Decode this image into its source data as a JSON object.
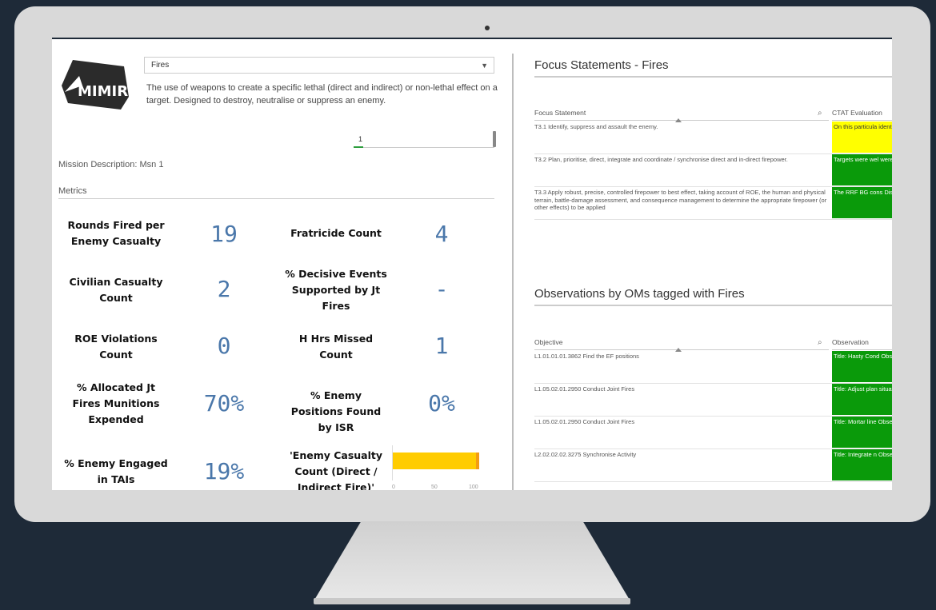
{
  "logo": {
    "text": "MIMIR"
  },
  "filter": {
    "selected": "Fires"
  },
  "description": "The use of weapons to create a specific lethal (direct and indirect) or non-lethal effect on a target. Designed to destroy, neutralise or suppress an enemy.",
  "slider": {
    "value": "1"
  },
  "mission": "Mission Description: Msn 1",
  "metrics_title": "Metrics",
  "metrics": {
    "rounds_fired": {
      "label": "Rounds Fired per Enemy Casualty",
      "value": "19"
    },
    "fratricide": {
      "label": "Fratricide Count",
      "value": "4"
    },
    "civilian": {
      "label": "Civilian Casualty Count",
      "value": "2"
    },
    "decisive": {
      "label": "% Decisive Events Supported by Jt Fires",
      "value": "-"
    },
    "roe": {
      "label": "ROE Violations Count",
      "value": "0"
    },
    "hhrs": {
      "label": "H Hrs Missed Count",
      "value": "1"
    },
    "allocated": {
      "label": "% Allocated Jt Fires Munitions Expended",
      "value": "70%"
    },
    "positions": {
      "label": "% Enemy Positions Found by ISR",
      "value": "0%"
    },
    "engaged": {
      "label": "% Enemy Engaged in TAIs",
      "value": "19%"
    },
    "casualty_chart": {
      "label": "'Enemy Casualty Count (Direct / Indirect Fire)'"
    }
  },
  "chart_data": {
    "type": "bar",
    "orientation": "horizontal",
    "series": [
      {
        "values": [
          96
        ]
      },
      {
        "values": [
          4
        ]
      }
    ],
    "stacked": true,
    "xlim": [
      0,
      100
    ],
    "ticks": [
      "0",
      "50",
      "100"
    ],
    "colors": [
      "#ffcc00",
      "#f39c12"
    ]
  },
  "focus": {
    "title": "Focus Statements - Fires",
    "col1": "Focus Statement",
    "col2": "CTAT Evaluation",
    "rows": [
      {
        "statement": "T3.1 Identify, suppress and assault the enemy.",
        "evaluation": "On this particula identify and supp a conplan that lef",
        "color": "yellow"
      },
      {
        "statement": "T3.2 Plan, prioritise, direct, integrate and coordinate / synchronise direct and in-direct firepower.",
        "evaluation": "Targets were wel were planned in a coordination was",
        "color": "green"
      },
      {
        "statement": "T3.3 Apply robust, precise, controlled firepower to best effect, taking account of ROE, the human and physical terrain, battle-damage assessment, and consequence management to determine the appropriate firepower (or other effects) to be applied",
        "evaluation": "The RRF BG cons Discovering the r by civilians, the B",
        "color": "green"
      }
    ]
  },
  "observations": {
    "title": "Observations by OMs tagged with Fires",
    "col1": "Objective",
    "col2": "Observation",
    "rows": [
      {
        "objective": "L1.01.01.01.3862 Find the EF positions",
        "observation": "Title: Hasty Cond Observation: The time pressure, to"
      },
      {
        "objective": "L1.05.02.01.2950 Conduct Joint Fires",
        "observation": "Title: Adjust plan situation. Observation: Bei"
      },
      {
        "objective": "L1.05.02.01.2950 Conduct Joint Fires",
        "observation": "Title: Mortar line Observation: BLU"
      },
      {
        "objective": "L2.02.02.02.3275 Synchronise Activity",
        "observation": "Title: Integrate n Observation: The their objective. T"
      }
    ]
  }
}
